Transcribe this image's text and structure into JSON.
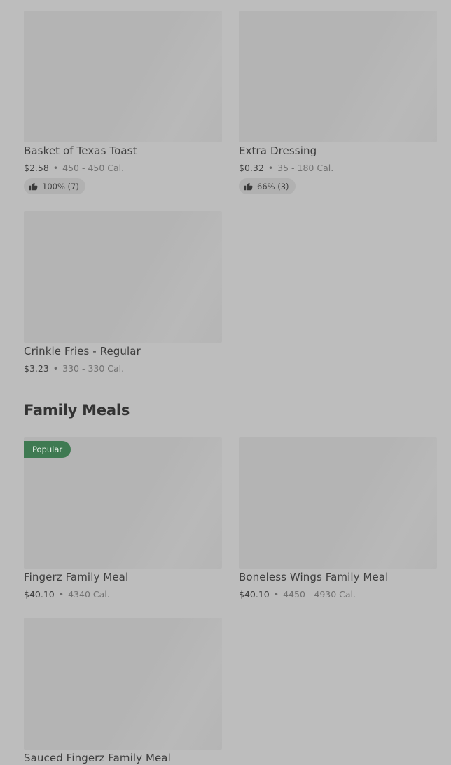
{
  "top_items": [
    {
      "name": "Basket of Texas Toast",
      "price": "$2.58",
      "calories": "450 - 450 Cal.",
      "rating": "100% (7)"
    },
    {
      "name": "Extra Dressing",
      "price": "$0.32",
      "calories": "35 - 180 Cal.",
      "rating": "66% (3)"
    },
    {
      "name": "Crinkle Fries - Regular",
      "price": "$3.23",
      "calories": "330 - 330 Cal."
    }
  ],
  "family_meals": {
    "title": "Family Meals",
    "items": [
      {
        "name": "Fingerz Family Meal",
        "price": "$40.10",
        "calories": "4340 Cal.",
        "badge": "Popular"
      },
      {
        "name": "Boneless Wings Family Meal",
        "price": "$40.10",
        "calories": "4450 - 4930 Cal."
      },
      {
        "name": "Sauced Fingerz Family Meal"
      }
    ]
  },
  "separator": "•",
  "icons": {
    "rating": "thumbs-up-icon"
  },
  "colors": {
    "badge": "#3f7a52",
    "overlay": "#bdbdbd"
  }
}
